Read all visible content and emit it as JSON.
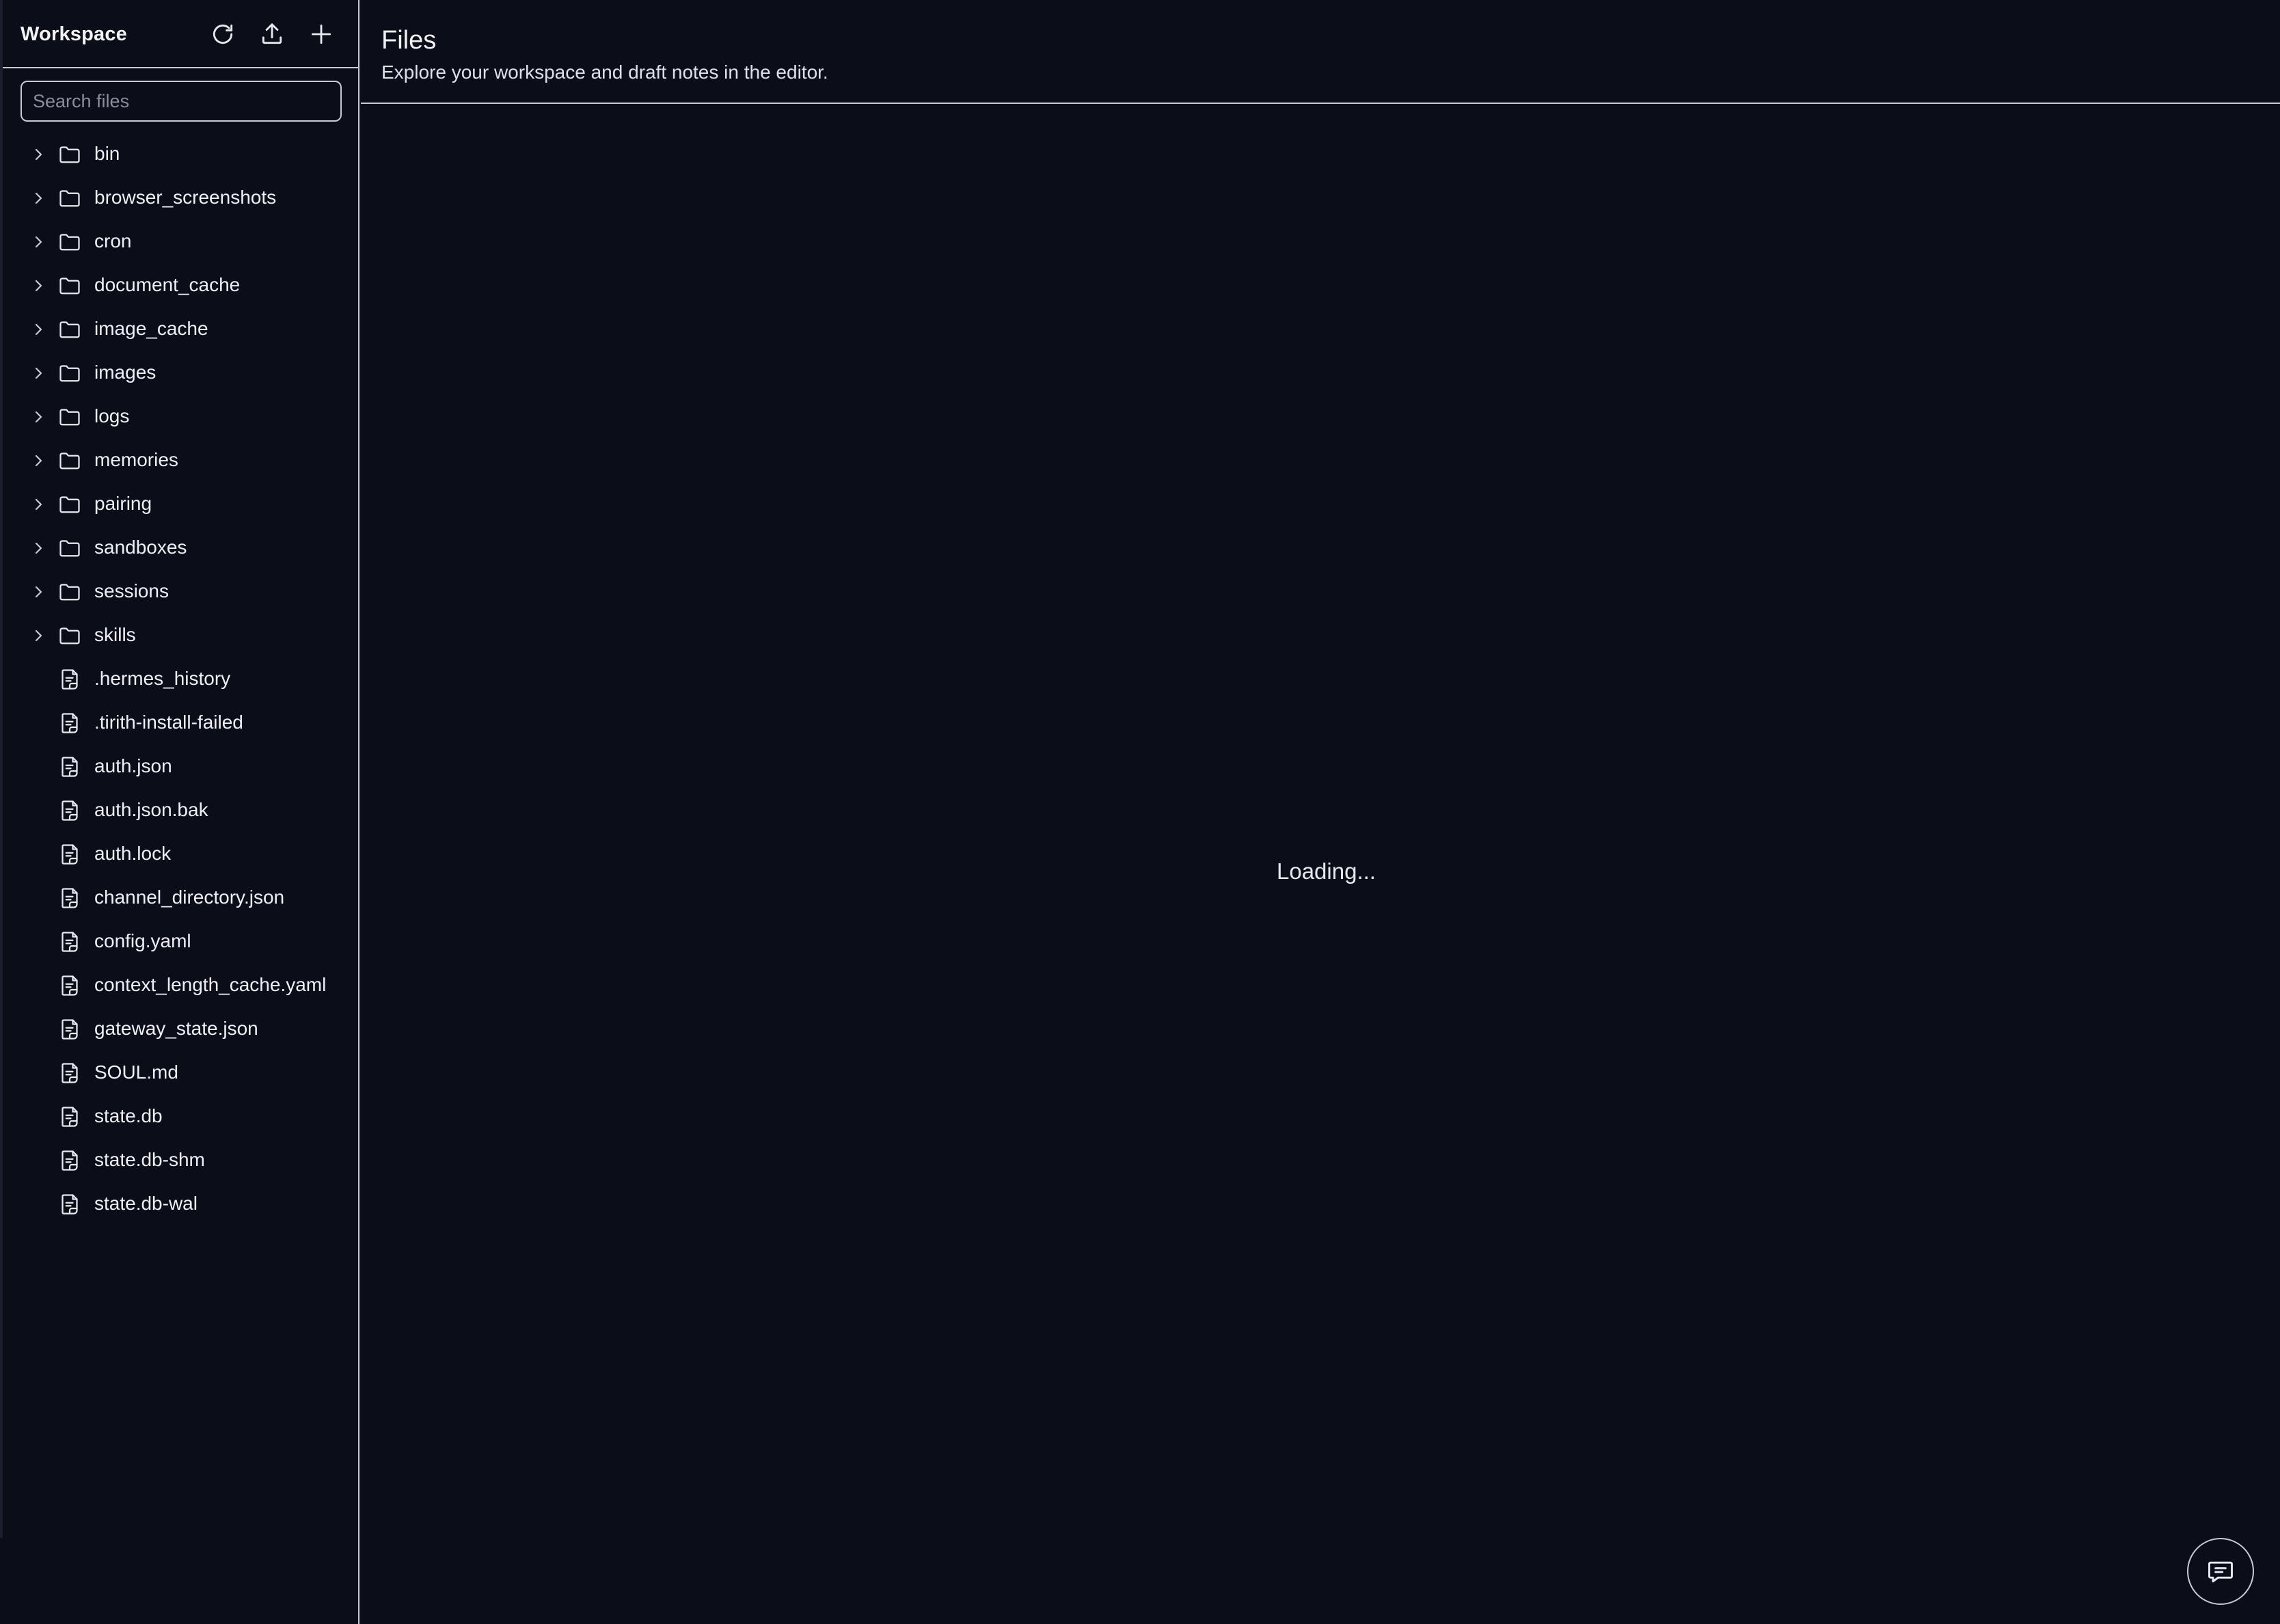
{
  "sidebar": {
    "title": "Workspace",
    "actions": {
      "refresh": "refresh-icon",
      "upload": "upload-icon",
      "add": "plus-icon"
    },
    "search": {
      "placeholder": "Search files",
      "value": ""
    },
    "folders": [
      "bin",
      "browser_screenshots",
      "cron",
      "document_cache",
      "image_cache",
      "images",
      "logs",
      "memories",
      "pairing",
      "sandboxes",
      "sessions",
      "skills"
    ],
    "files": [
      ".hermes_history",
      ".tirith-install-failed",
      "auth.json",
      "auth.json.bak",
      "auth.lock",
      "channel_directory.json",
      "config.yaml",
      "context_length_cache.yaml",
      "gateway_state.json",
      "SOUL.md",
      "state.db",
      "state.db-shm",
      "state.db-wal"
    ]
  },
  "main": {
    "title": "Files",
    "subtitle": "Explore your workspace and draft notes in the editor.",
    "status": "Loading..."
  },
  "chat_button": {
    "icon": "chat-icon"
  },
  "colors": {
    "background": "#0b0d18",
    "border": "#c9cbd4",
    "text": "#eef0f5"
  }
}
